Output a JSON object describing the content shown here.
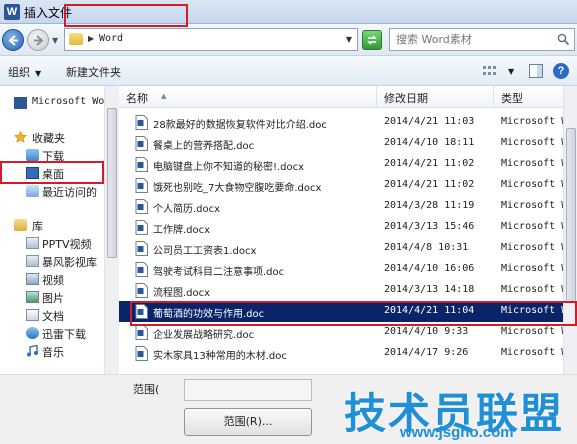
{
  "window": {
    "title": "插入文件",
    "app_icon": "word-icon"
  },
  "address_bar": {
    "path_segment": "Word",
    "folder_icon": "folder-icon"
  },
  "search": {
    "placeholder": "搜索 Word素材"
  },
  "toolbar": {
    "organize_label": "组织",
    "new_folder_label": "新建文件夹"
  },
  "sidebar": {
    "items": [
      {
        "label": "Microsoft Wo",
        "icon": "word-icon"
      },
      {
        "label": "收藏夹",
        "icon": "star-icon"
      },
      {
        "label": "下载",
        "icon": "download-folder-icon"
      },
      {
        "label": "桌面",
        "icon": "desktop-icon"
      },
      {
        "label": "最近访问的",
        "icon": "recent-places-icon"
      },
      {
        "label": "库",
        "icon": "library-icon"
      },
      {
        "label": "PPTV视频",
        "icon": "video-folder-icon"
      },
      {
        "label": "暴风影视库",
        "icon": "video-folder-icon"
      },
      {
        "label": "视频",
        "icon": "video-library-icon"
      },
      {
        "label": "图片",
        "icon": "pictures-library-icon"
      },
      {
        "label": "文档",
        "icon": "documents-library-icon"
      },
      {
        "label": "迅雷下载",
        "icon": "thunder-download-icon"
      },
      {
        "label": "音乐",
        "icon": "music-library-icon"
      }
    ]
  },
  "file_list": {
    "columns": [
      {
        "label": "名称"
      },
      {
        "label": "修改日期"
      },
      {
        "label": "类型"
      }
    ],
    "rows": [
      {
        "name": "28款最好的数据恢复软件对比介绍.doc",
        "date": "2014/4/21 11:03",
        "type": "Microsoft Wo"
      },
      {
        "name": "餐桌上的营养搭配.doc",
        "date": "2014/4/10 18:11",
        "type": "Microsoft Wo"
      },
      {
        "name": "电脑键盘上你不知道的秘密!.docx",
        "date": "2014/4/21 11:02",
        "type": "Microsoft Wo"
      },
      {
        "name": "饿死也别吃_7大食物空腹吃要命.docx",
        "date": "2014/4/21 11:02",
        "type": "Microsoft Wo"
      },
      {
        "name": "个人简历.docx",
        "date": "2014/3/28 11:19",
        "type": "Microsoft Wo"
      },
      {
        "name": "工作牌.docx",
        "date": "2014/3/13 15:46",
        "type": "Microsoft Wo"
      },
      {
        "name": "公司员工工资表1.docx",
        "date": "2014/4/8 10:31",
        "type": "Microsoft Wo"
      },
      {
        "name": "驾驶考试科目二注意事项.doc",
        "date": "2014/4/10 16:06",
        "type": "Microsoft Wo"
      },
      {
        "name": "流程图.docx",
        "date": "2014/3/13 14:18",
        "type": "Microsoft Wo"
      },
      {
        "name": "葡萄酒的功效与作用.doc",
        "date": "2014/4/21 11:04",
        "type": "Microsoft Wo"
      },
      {
        "name": "企业发展战略研究.doc",
        "date": "2014/4/10 9:33",
        "type": "Microsoft Wo"
      },
      {
        "name": "实木家具13种常用的木材.doc",
        "date": "2014/4/17 9:26",
        "type": "Microsoft Wo"
      }
    ]
  },
  "bottom": {
    "range_label": "范围(",
    "range_button_label": "范围(R)..."
  },
  "watermark": {
    "main": "技术员联盟",
    "url": "www.jsgho.com"
  }
}
